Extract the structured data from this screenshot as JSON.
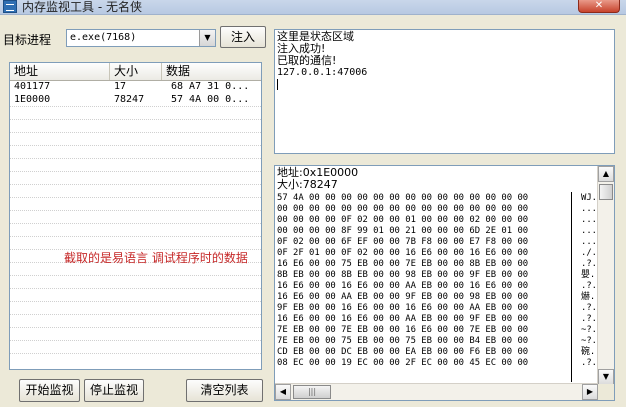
{
  "window": {
    "title": "内存监视工具 - 无名侠",
    "close_label": "✕"
  },
  "target": {
    "label": "目标进程",
    "process_value": "e.exe(7168)",
    "inject_label": "注入"
  },
  "list": {
    "columns": [
      "地址",
      "大小",
      "数据"
    ],
    "rows": [
      {
        "addr": "401177",
        "size": "17",
        "data": "68 A7 31 0..."
      },
      {
        "addr": "1E0000",
        "size": "78247",
        "data": "57 4A 00 0..."
      }
    ],
    "note": "截取的是易语言 调试程序时的数据"
  },
  "status": {
    "lines": [
      "这里是状态区域",
      "注入成功!",
      "已取的通信!"
    ],
    "address": "127.0.0.1:47006"
  },
  "hex": {
    "address_line": "地址:0x1E0000",
    "size_line": "大小:78247",
    "rows": [
      "57 4A 00 00 00 00 00 00 00 00 00 00 00 00 00 00",
      "00 00 00 00 00 00 00 00 00 00 00 00 00 00 00 00",
      "00 00 00 00 0F 02 00 00 01 00 00 00 02 00 00 00",
      "00 00 00 00 8F 99 01 00 21 00 00 00 6D 2E 01 00",
      "0F 02 00 00 6F EF 00 00 7B F8 00 00 E7 F8 00 00",
      "0F 2F 01 00 0F 02 00 00 16 E6 00 00 16 E6 00 00",
      "16 E6 00 00 75 EB 00 00 7E EB 00 00 8B EB 00 00",
      "8B EB 00 00 8B EB 00 00 98 EB 00 00 9F EB 00 00",
      "16 E6 00 00 16 E6 00 00 AA EB 00 00 16 E6 00 00",
      "16 E6 00 00 AA EB 00 00 9F EB 00 00 98 EB 00 00",
      "9F EB 00 00 16 E6 00 00 16 E6 00 00 AA EB 00 00",
      "16 E6 00 00 16 E6 00 00 AA EB 00 00 9F EB 00 00",
      "7E EB 00 00 7E EB 00 00 16 E6 00 00 7E EB 00 00",
      "7E EB 00 00 75 EB 00 00 75 EB 00 00 B4 EB 00 00",
      "CD EB 00 00 DC EB 00 00 EA EB 00 00 F6 EB 00 00",
      "08 EC 00 00 19 EC 00 00 2F EC 00 00 45 EC 00 00"
    ],
    "ascii": [
      "WJ.",
      "...",
      "...",
      "...",
      "...",
      "./.",
      ".?.",
      "嬰.",
      ".?.",
      "爀.",
      ".?.",
      ".?.",
      "~?.",
      "~?.",
      "碗.",
      ".?."
    ]
  },
  "buttons": {
    "start": "开始监视",
    "stop": "停止监视",
    "clear": "清空列表"
  },
  "icons": {
    "app": "app-icon",
    "dropdown": "chevron-down-icon"
  }
}
